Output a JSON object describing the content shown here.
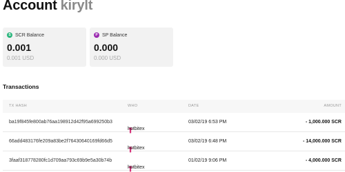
{
  "header": {
    "title": "Account",
    "username": "kirylt"
  },
  "balances": [
    {
      "token_icon": "S",
      "label": "SCR Balance",
      "value": "0.001",
      "usd": "0.001 USD",
      "color": "#2cb67d"
    },
    {
      "token_icon": "P",
      "label": "SP Balance",
      "value": "0.000",
      "usd": "0.000 USD",
      "color": "#9b2bb0"
    }
  ],
  "transactions": {
    "title": "Transactions",
    "columns": {
      "hash": "TX HASH",
      "who": "WHO",
      "date": "DATE",
      "amount": "AMOUNT"
    },
    "rows": [
      {
        "hash": "ba19f845fe800ab76aa198912d42f95a699250b3",
        "who": "hotbitex",
        "date": "03/02/19 6:53 PM",
        "amount": "- 1,000.000 SCR"
      },
      {
        "hash": "66add483176fe209a83be2f76430640169fd66d5",
        "who": "hotbitex",
        "date": "03/02/19 6:48 PM",
        "amount": "- 14,000.000 SCR"
      },
      {
        "hash": "3faaf318778280fc1d709aa793c69b9e5a30b74b",
        "who": "hotbitex",
        "date": "01/02/19 9:06 PM",
        "amount": "- 4,000.000 SCR"
      }
    ],
    "direction_icon": "arrow-up-outgoing-icon",
    "direction_color": "#d6337a"
  }
}
